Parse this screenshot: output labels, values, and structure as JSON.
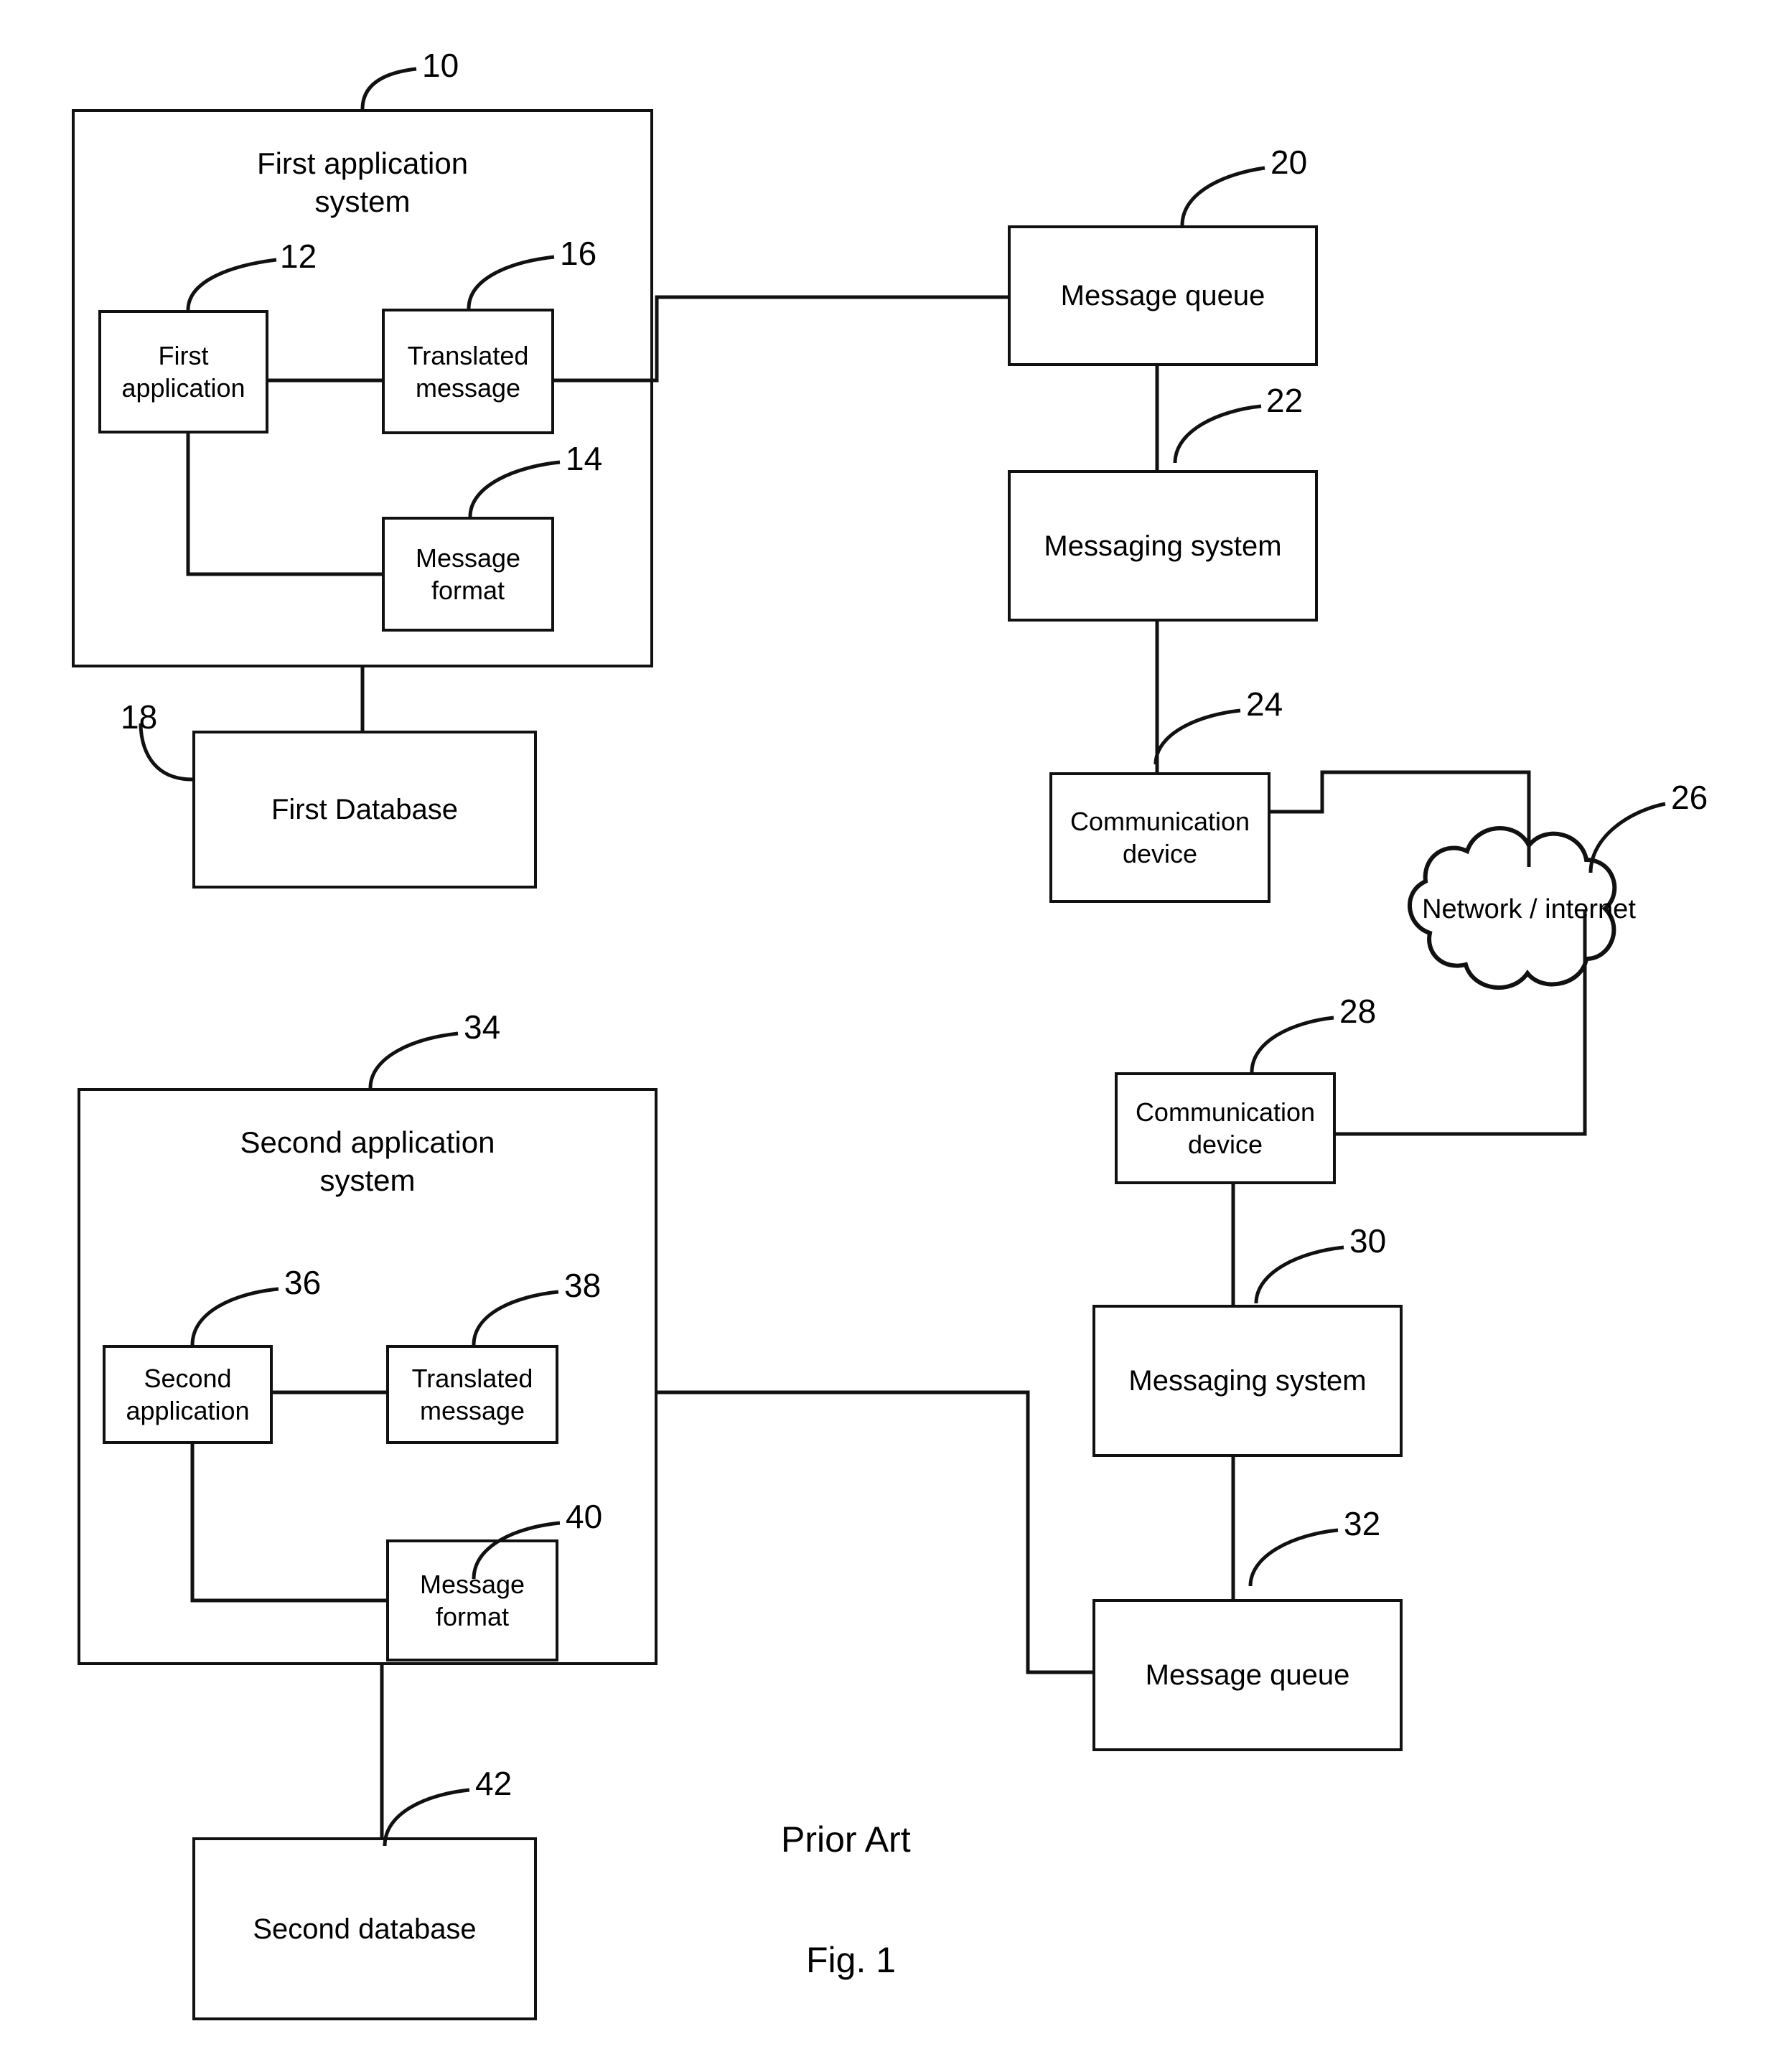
{
  "figure": {
    "caption_prior_art": "Prior Art",
    "caption_figure": "Fig. 1"
  },
  "nodes": {
    "first_application_system": {
      "label": "First application\nsystem",
      "ref": "10"
    },
    "first_application": {
      "label": "First\napplication",
      "ref": "12"
    },
    "message_format_1": {
      "label": "Message\nformat",
      "ref": "14"
    },
    "translated_message_1": {
      "label": "Translated\nmessage",
      "ref": "16"
    },
    "first_database": {
      "label": "First Database",
      "ref": "18"
    },
    "message_queue_1": {
      "label": "Message queue",
      "ref": "20"
    },
    "messaging_system_1": {
      "label": "Messaging system",
      "ref": "22"
    },
    "communication_device_1": {
      "label": "Communication\ndevice",
      "ref": "24"
    },
    "network_internet": {
      "label": "Network / internet",
      "ref": "26"
    },
    "communication_device_2": {
      "label": "Communication\ndevice",
      "ref": "28"
    },
    "messaging_system_2": {
      "label": "Messaging system",
      "ref": "30"
    },
    "message_queue_2": {
      "label": "Message queue",
      "ref": "32"
    },
    "second_application_system": {
      "label": "Second application\nsystem",
      "ref": "34"
    },
    "second_application": {
      "label": "Second\napplication",
      "ref": "36"
    },
    "translated_message_2": {
      "label": "Translated\nmessage",
      "ref": "38"
    },
    "message_format_2": {
      "label": "Message\nformat",
      "ref": "40"
    },
    "second_database": {
      "label": "Second database",
      "ref": "42"
    }
  },
  "style": {
    "stroke": "#111111",
    "background": "#ffffff"
  }
}
